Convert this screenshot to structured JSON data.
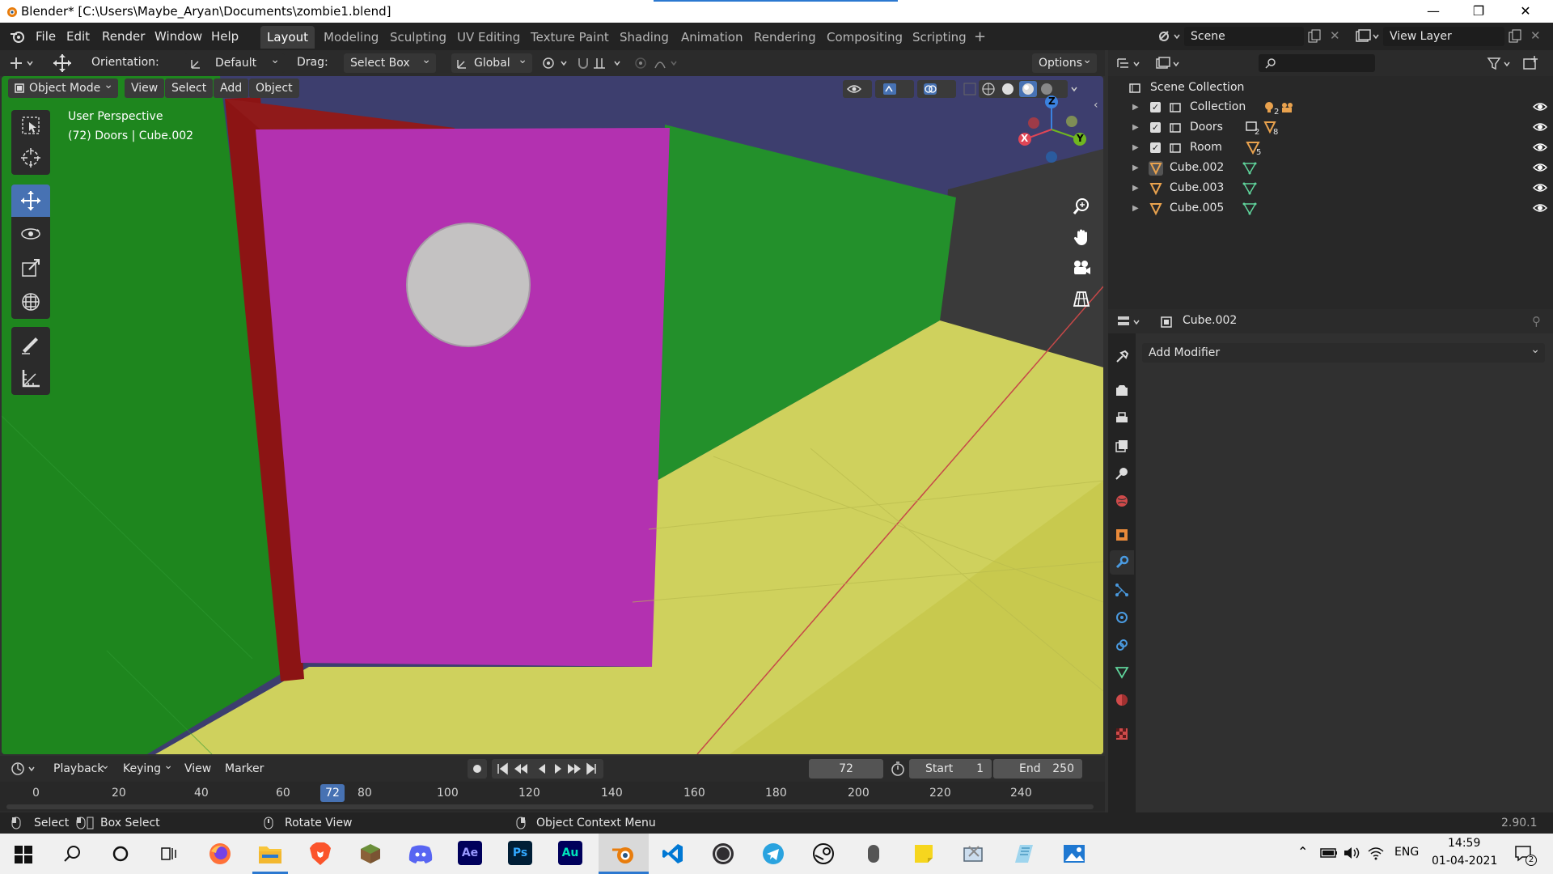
{
  "window": {
    "title": "Blender* [C:\\Users\\Maybe_Aryan\\Documents\\zombie1.blend]",
    "minimize": "—",
    "restore": "❐",
    "close": "✕"
  },
  "menu": {
    "items": [
      "File",
      "Edit",
      "Render",
      "Window",
      "Help"
    ],
    "workspaces": [
      "Layout",
      "Modeling",
      "Sculpting",
      "UV Editing",
      "Texture Paint",
      "Shading",
      "Animation",
      "Rendering",
      "Compositing",
      "Scripting"
    ],
    "add_workspace": "+",
    "scene": "Scene",
    "view_layer": "View Layer"
  },
  "header": {
    "orientation_label": "Orientation:",
    "orientation_value": "Default",
    "drag_label": "Drag:",
    "drag_value": "Select Box",
    "transform_space": "Global",
    "options": "Options"
  },
  "viewport_header": {
    "mode": "Object Mode",
    "menus": [
      "View",
      "Select",
      "Add",
      "Object"
    ]
  },
  "viewport": {
    "perspective": "User Perspective",
    "context": "(72) Doors | Cube.002",
    "gizmo": {
      "z": "Z",
      "x": "X",
      "y": "Y"
    }
  },
  "outliner": {
    "root": "Scene Collection",
    "items": [
      {
        "name": "Collection",
        "badge1": "2",
        "badge2": ""
      },
      {
        "name": "Doors",
        "badge1": "2",
        "badge2": "8"
      },
      {
        "name": "Room",
        "badge1": "5",
        "badge2": ""
      },
      {
        "name": "Cube.002"
      },
      {
        "name": "Cube.003"
      },
      {
        "name": "Cube.005"
      }
    ]
  },
  "properties": {
    "object": "Cube.002",
    "add_modifier": "Add Modifier"
  },
  "timeline": {
    "menus": [
      "Playback",
      "Keying",
      "View",
      "Marker"
    ],
    "current_frame": "72",
    "start_label": "Start",
    "start_value": "1",
    "end_label": "End",
    "end_value": "250",
    "ticks": [
      "0",
      "20",
      "40",
      "60",
      "80",
      "100",
      "120",
      "140",
      "160",
      "180",
      "200",
      "220",
      "240"
    ],
    "playhead": "72"
  },
  "status": {
    "select": "Select",
    "box_select": "Box Select",
    "rotate_view": "Rotate View",
    "context_menu": "Object Context Menu",
    "version": "2.90.1"
  },
  "taskbar": {
    "lang": "ENG",
    "time": "14:59",
    "date": "01-04-2021",
    "notif_count": "2",
    "apps": [
      "Ae",
      "Ps",
      "Au"
    ]
  },
  "colors": {
    "wall_green": "#1f8a1f",
    "door_magenta": "#b331b0",
    "floor_yellow": "#cdd15a",
    "door_frame": "#8c1414",
    "accent_blue": "#4772b3"
  }
}
